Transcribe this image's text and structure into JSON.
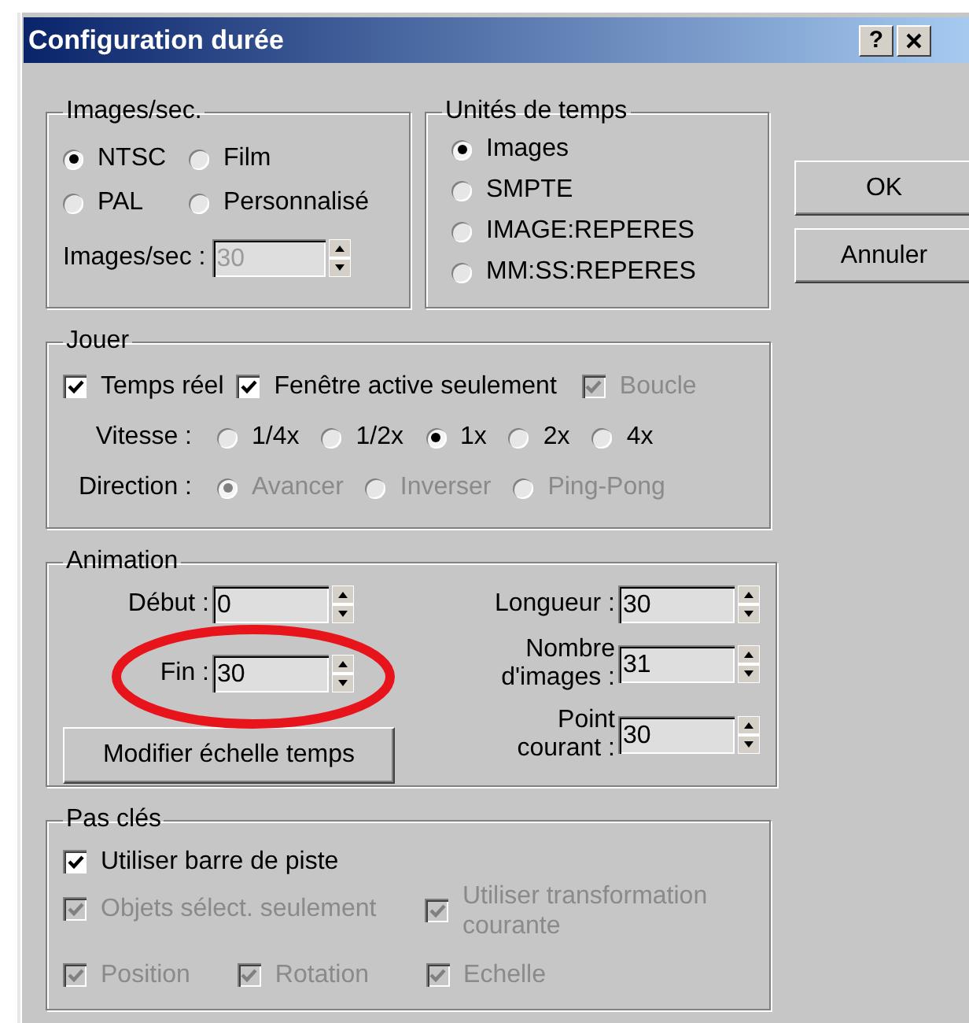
{
  "window": {
    "title": "Configuration durée",
    "help": "?"
  },
  "frame_rate": {
    "title": "Images/sec.",
    "options": [
      {
        "label": "NTSC",
        "selected": true
      },
      {
        "label": "Film",
        "selected": false
      },
      {
        "label": "PAL",
        "selected": false
      },
      {
        "label": "Personnalisé",
        "selected": false
      }
    ],
    "field": {
      "label": "Images/sec :",
      "value": "30",
      "disabled": true
    }
  },
  "time_units": {
    "title": "Unités de temps",
    "options": [
      {
        "label": "Images",
        "selected": true
      },
      {
        "label": "SMPTE",
        "selected": false
      },
      {
        "label": "IMAGE:REPERES",
        "selected": false
      },
      {
        "label": "MM:SS:REPERES",
        "selected": false
      }
    ]
  },
  "buttons": [
    {
      "label": "OK"
    },
    {
      "label": "Annuler"
    }
  ],
  "playback": {
    "title": "Jouer",
    "checkboxes": [
      {
        "label": "Temps réel",
        "checked": true,
        "disabled": false
      },
      {
        "label": "Fenêtre active seulement",
        "checked": true,
        "disabled": false
      },
      {
        "label": "Boucle",
        "checked": true,
        "disabled": true
      }
    ],
    "speed": {
      "label": "Vitesse :",
      "disabled": false,
      "options": [
        {
          "label": "1/4x",
          "selected": false
        },
        {
          "label": "1/2x",
          "selected": false
        },
        {
          "label": "1x",
          "selected": true
        },
        {
          "label": "2x",
          "selected": false
        },
        {
          "label": "4x",
          "selected": false
        }
      ]
    },
    "direction": {
      "label": "Direction :",
      "disabled": true,
      "options": [
        {
          "label": "Avancer",
          "selected": true
        },
        {
          "label": "Inverser",
          "selected": false
        },
        {
          "label": "Ping-Pong",
          "selected": false
        }
      ]
    }
  },
  "animation": {
    "title": "Animation",
    "left_fields": [
      {
        "label": "Début :",
        "value": "0"
      },
      {
        "label": "Fin :",
        "value": "30"
      }
    ],
    "button": "Modifier échelle temps",
    "right_fields": [
      {
        "label": "Longueur :",
        "value": "30"
      },
      {
        "label": "Nombre d'images :",
        "value": "31"
      },
      {
        "label": "Point courant :",
        "value": "30"
      }
    ],
    "annotation": {
      "kind": "ellipse"
    }
  },
  "key_steps": {
    "title": "Pas clés",
    "checkboxes": [
      {
        "label": "Utiliser barre de piste",
        "checked": true,
        "disabled": false
      },
      {
        "label": "Objets sélect. seulement",
        "checked": true,
        "disabled": true
      },
      {
        "label": "Utiliser transformation courante",
        "checked": true,
        "disabled": true
      },
      {
        "label": "Position",
        "checked": true,
        "disabled": true
      },
      {
        "label": "Rotation",
        "checked": true,
        "disabled": true
      },
      {
        "label": "Echelle",
        "checked": true,
        "disabled": true
      }
    ]
  }
}
